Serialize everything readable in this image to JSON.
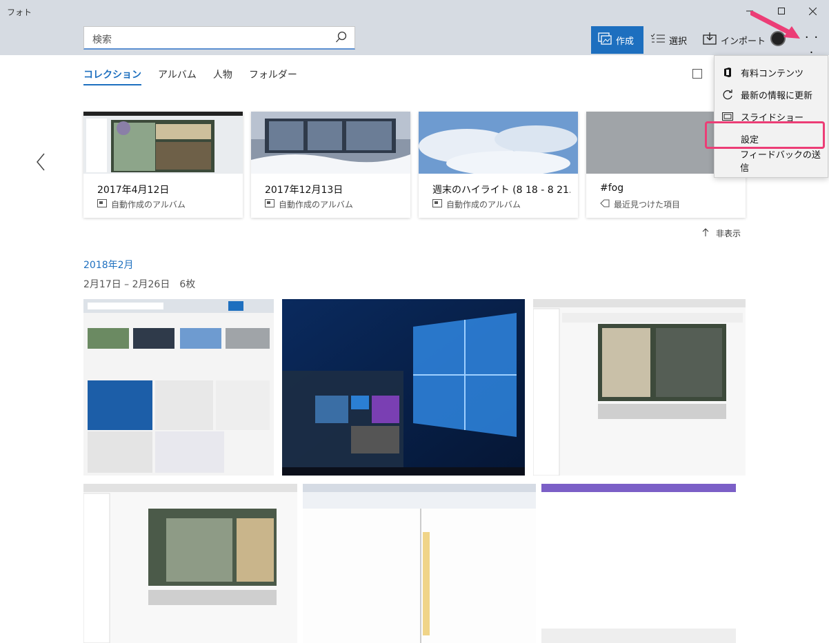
{
  "app": {
    "title": "フォト"
  },
  "search": {
    "placeholder": "検索"
  },
  "toolbar": {
    "create": "作成",
    "select": "選択",
    "import": "インポート"
  },
  "tabs": [
    "コレクション",
    "アルバム",
    "人物",
    "フォルダー"
  ],
  "albums": [
    {
      "title": "2017年4月12日",
      "subtitle": "自動作成のアルバム",
      "icon": "album-icon"
    },
    {
      "title": "2017年12月13日",
      "subtitle": "自動作成のアルバム",
      "icon": "album-icon"
    },
    {
      "title": "週末のハイライト (8 18 - 8 21...",
      "subtitle": "自動作成のアルバム",
      "icon": "album-icon"
    },
    {
      "title": "#fog",
      "subtitle": "最近見つけた項目",
      "icon": "tag-icon"
    }
  ],
  "hide_label": "非表示",
  "section": {
    "month": "2018年2月",
    "range": "2月17日 – 2月26日　6枚"
  },
  "menu": {
    "items": [
      {
        "label": "有料コンテンツ",
        "icon": "office-icon"
      },
      {
        "label": "最新の情報に更新",
        "icon": "refresh-icon"
      },
      {
        "label": "スライドショー",
        "icon": "slideshow-icon"
      },
      {
        "label": "設定",
        "icon": ""
      },
      {
        "label": "フィードバックの送信",
        "icon": ""
      }
    ]
  },
  "colors": {
    "accent": "#1d6fbf",
    "highlight": "#ec3d76",
    "chrome": "#d6dbe2"
  }
}
